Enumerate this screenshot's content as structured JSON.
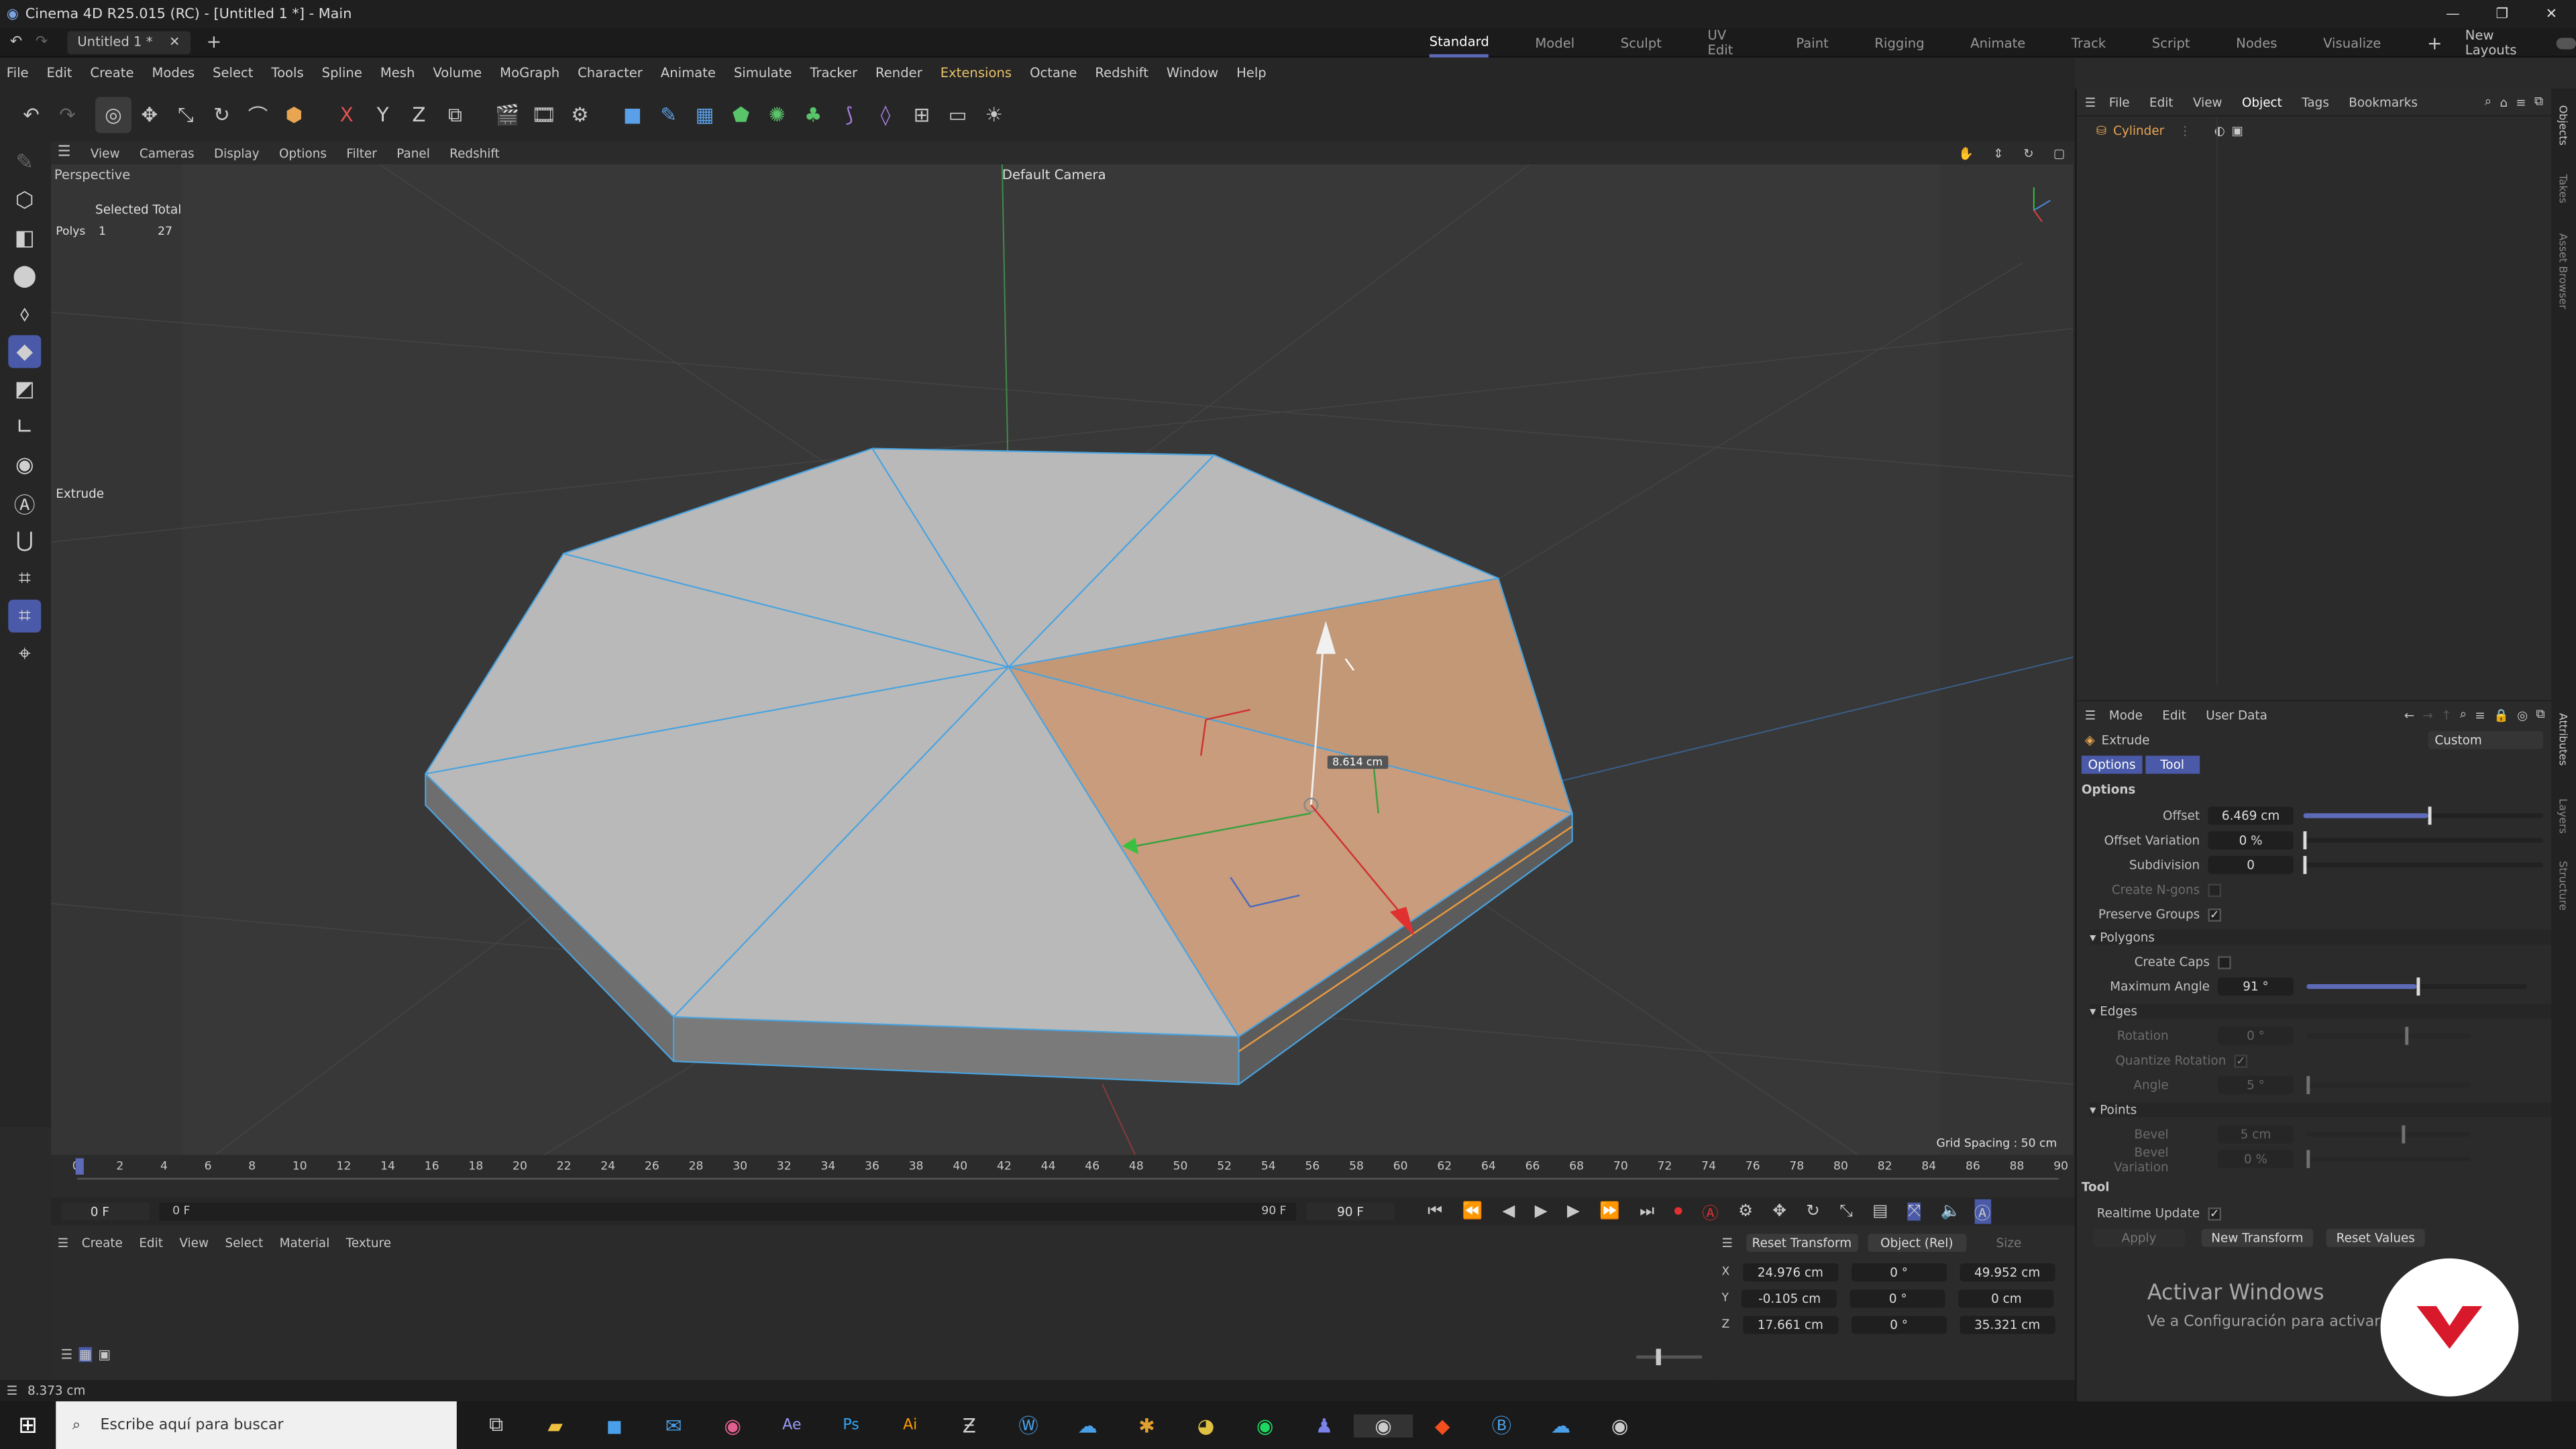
{
  "window": {
    "title": "Cinema 4D R25.015 (RC) - [Untitled 1 *] - Main"
  },
  "doc_tab": {
    "label": "Untitled 1 *"
  },
  "layouts": [
    "Standard",
    "Model",
    "Sculpt",
    "UV Edit",
    "Paint",
    "Rigging",
    "Animate",
    "Track",
    "Script",
    "Nodes",
    "Visualize"
  ],
  "new_layouts": "New Layouts",
  "menu": [
    "File",
    "Edit",
    "Create",
    "Modes",
    "Select",
    "Tools",
    "Spline",
    "Mesh",
    "Volume",
    "MoGraph",
    "Character",
    "Animate",
    "Simulate",
    "Tracker",
    "Render",
    "Extensions",
    "Octane",
    "Redshift",
    "Window",
    "Help"
  ],
  "axis_lock": {
    "x": "X",
    "y": "Y",
    "z": "Z"
  },
  "viewport": {
    "menu": [
      "View",
      "Cameras",
      "Display",
      "Options",
      "Filter",
      "Panel",
      "Redshift"
    ],
    "name": "Perspective",
    "camera": "Default Camera",
    "stats_header": "Selected Total",
    "stats_label": "Polys",
    "stats_selected": "1",
    "stats_total": "27",
    "tool_label": "Extrude",
    "handle_value": "8.614 cm",
    "grid_spacing": "Grid Spacing : 50 cm"
  },
  "timeline": {
    "ticks": [
      "0",
      "2",
      "4",
      "6",
      "8",
      "10",
      "12",
      "14",
      "16",
      "18",
      "20",
      "22",
      "24",
      "26",
      "28",
      "30",
      "32",
      "34",
      "36",
      "38",
      "40",
      "42",
      "44",
      "46",
      "48",
      "50",
      "52",
      "54",
      "56",
      "58",
      "60",
      "62",
      "64",
      "66",
      "68",
      "70",
      "72",
      "74",
      "76",
      "78",
      "80",
      "82",
      "84",
      "86",
      "88",
      "90"
    ]
  },
  "transport": {
    "current": "0 F",
    "start": "0 F",
    "end_a": "90 F",
    "end_b": "90 F"
  },
  "material_menu": [
    "Create",
    "Edit",
    "View",
    "Select",
    "Material",
    "Texture"
  ],
  "coord": {
    "reset": "Reset Transform",
    "mode": "Object (Rel)",
    "size": "Size",
    "rows": [
      {
        "axis": "X",
        "pos": "24.976 cm",
        "rot": "0 °",
        "size": "49.952 cm"
      },
      {
        "axis": "Y",
        "pos": "-0.105 cm",
        "rot": "0 °",
        "size": "0 cm"
      },
      {
        "axis": "Z",
        "pos": "17.661 cm",
        "rot": "0 °",
        "size": "35.321 cm"
      }
    ]
  },
  "status": "8.373 cm",
  "objects": {
    "menu": [
      "File",
      "Edit",
      "View",
      "Object",
      "Tags",
      "Bookmarks"
    ],
    "item": "Cylinder"
  },
  "attributes": {
    "menu": [
      "Mode",
      "Edit",
      "User Data"
    ],
    "tool": "Extrude",
    "preset": "Custom",
    "tabs": [
      "Options",
      "Tool"
    ],
    "options_header": "Options",
    "offset_label": "Offset",
    "offset_value": "6.469 cm",
    "offset_pct": 0.52,
    "offset_var_label": "Offset Variation",
    "offset_var_value": "0 %",
    "subdivision_label": "Subdivision",
    "subdivision_value": "0",
    "create_ngons_label": "Create N-gons",
    "preserve_groups_label": "Preserve Groups",
    "polygons_header": "Polygons",
    "create_caps_label": "Create Caps",
    "max_angle_label": "Maximum Angle",
    "max_angle_value": "91 °",
    "max_angle_pct": 0.5,
    "edges_header": "Edges",
    "rotation_label": "Rotation",
    "rotation_value": "0 °",
    "quantize_label": "Quantize Rotation",
    "angle_label": "Angle",
    "angle_value": "5 °",
    "points_header": "Points",
    "bevel_label": "Bevel",
    "bevel_value": "5 cm",
    "bevel_var_label": "Bevel Variation",
    "bevel_var_value": "0 %",
    "tool_header": "Tool",
    "realtime_label": "Realtime Update",
    "apply": "Apply",
    "new_transform": "New Transform",
    "reset_values": "Reset Values"
  },
  "side_tabs": [
    "Objects",
    "Takes",
    "Asset Browser",
    "Attributes",
    "Layers",
    "Structure"
  ],
  "watermark": {
    "title": "Activar Windows",
    "subtitle": "Ve a Configuración para activar"
  },
  "taskbar": {
    "search_placeholder": "Escribe aquí para buscar"
  },
  "colors": {
    "accent": "#5c6ab8",
    "selection": "#c89a78",
    "edge": "#4aa3df"
  }
}
